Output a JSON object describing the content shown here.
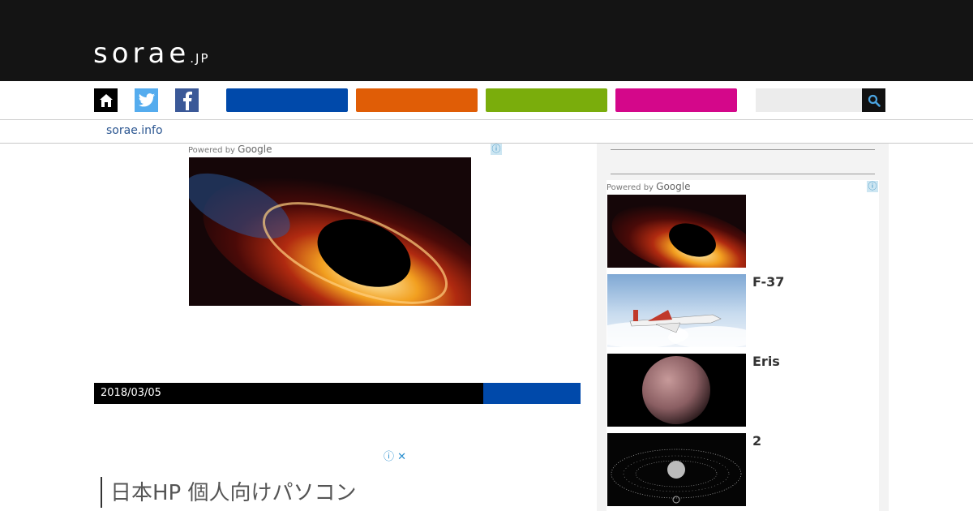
{
  "header": {
    "logo_main": "sorae",
    "logo_sub": ".JP"
  },
  "nav": {
    "social": [
      {
        "name": "home-icon",
        "bg": "#000000"
      },
      {
        "name": "twitter-icon",
        "bg": "#55acee"
      },
      {
        "name": "facebook-icon",
        "bg": "#3b5998"
      }
    ],
    "buttons": [
      {
        "color": "#0049aa"
      },
      {
        "color": "#e05d06"
      },
      {
        "color": "#7aad0c"
      },
      {
        "color": "#d4078a"
      }
    ],
    "search": {
      "placeholder": ""
    }
  },
  "subnav": {
    "link": "sorae.info"
  },
  "main_ad": {
    "powered_by": "Powered by",
    "google": "Google",
    "info": "ⓘ"
  },
  "article": {
    "date": "2018/03/05"
  },
  "sidebar": {
    "powered_by": "Powered by",
    "google": "Google",
    "info": "ⓘ",
    "items": [
      {
        "title": ""
      },
      {
        "title": "F-37"
      },
      {
        "title": " Eris"
      },
      {
        "title": "2"
      }
    ]
  },
  "bottom_ad": {
    "text": "日本HP 個人向けパソコン",
    "controls": "ⓘ ✕"
  }
}
